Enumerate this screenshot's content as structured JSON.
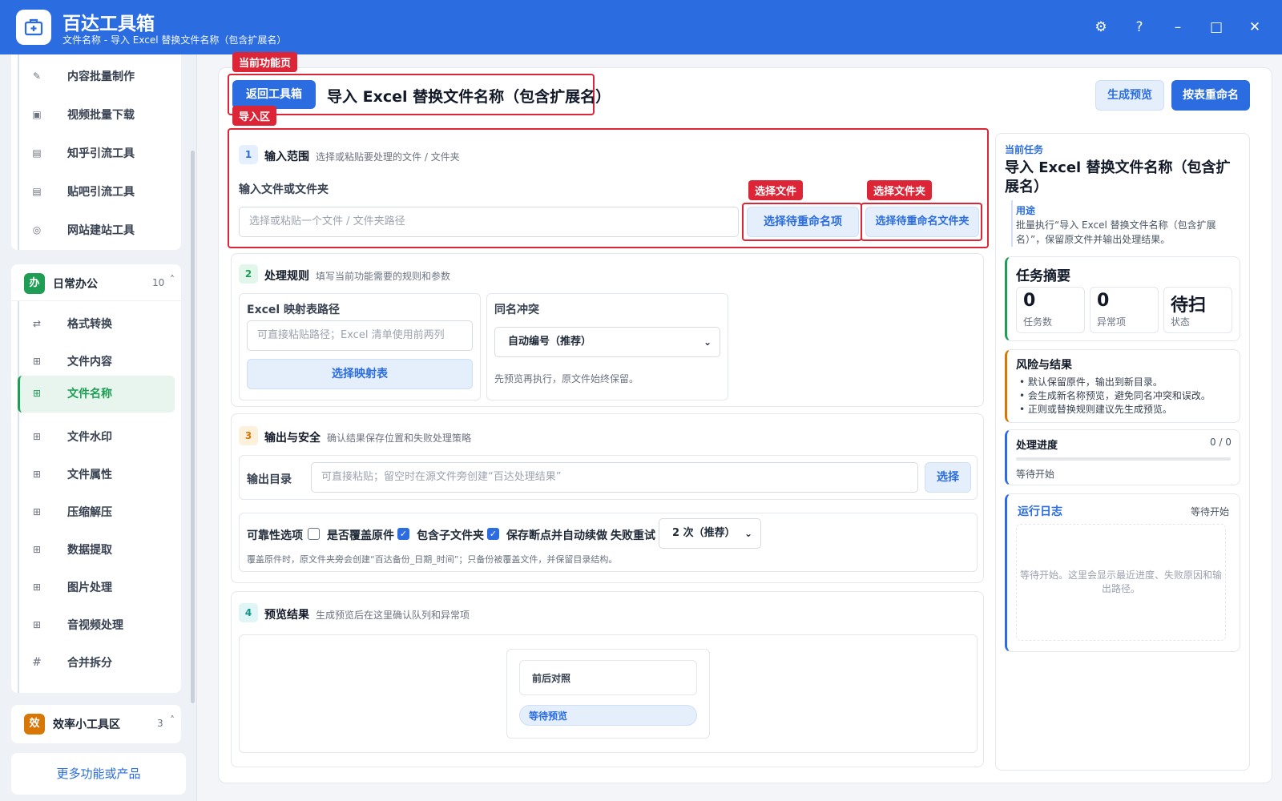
{
  "app": {
    "title": "百达工具箱",
    "subtitle": "文件名称 - 导入 Excel 替换文件名称（包含扩展名）"
  },
  "window_controls": {
    "settings": "⚙",
    "help": "?",
    "minimize": "–",
    "maximize": "□",
    "close": "✕"
  },
  "sidebar": {
    "top_items": [
      {
        "label": "内容批量制作",
        "icon": "pencil-icon"
      },
      {
        "label": "视频批量下载",
        "icon": "video-icon"
      },
      {
        "label": "知乎引流工具",
        "icon": "zhihu-icon"
      },
      {
        "label": "贴吧引流工具",
        "icon": "tieba-icon"
      },
      {
        "label": "网站建站工具",
        "icon": "globe-icon"
      }
    ],
    "group_office": {
      "badge": "办",
      "label": "日常办公",
      "count": "10",
      "chevron": "˄",
      "items": [
        {
          "label": "格式转换",
          "icon": "swap-icon"
        },
        {
          "label": "文件内容",
          "icon": "grid-icon"
        },
        {
          "label": "文件名称",
          "icon": "grid-icon",
          "active": true
        },
        {
          "label": "文件水印",
          "icon": "grid-icon"
        },
        {
          "label": "文件属性",
          "icon": "grid-icon"
        },
        {
          "label": "压缩解压",
          "icon": "grid-icon"
        },
        {
          "label": "数据提取",
          "icon": "grid-icon"
        },
        {
          "label": "图片处理",
          "icon": "grid-icon"
        },
        {
          "label": "音视频处理",
          "icon": "grid-icon"
        },
        {
          "label": "合并拆分",
          "icon": "hash-icon"
        }
      ]
    },
    "group_tools": {
      "badge": "效",
      "label": "效率小工具区",
      "count": "3",
      "chevron": "˄"
    },
    "more_link": "更多功能或产品"
  },
  "annotations": {
    "current_page": "当前功能页",
    "import_area": "导入区",
    "select_file": "选择文件",
    "select_folder": "选择文件夹"
  },
  "header": {
    "back_button": "返回工具箱",
    "page_title": "导入 Excel 替换文件名称（包含扩展名）",
    "preview_button": "生成预览",
    "rename_button": "按表重命名"
  },
  "section1": {
    "step": "1",
    "title": "输入范围",
    "desc": "选择或粘贴要处理的文件 / 文件夹",
    "field_label": "输入文件或文件夹",
    "input_placeholder": "选择或粘贴一个文件 / 文件夹路径",
    "select_items_button": "选择待重命名项",
    "select_folder_button": "选择待重命名文件夹"
  },
  "section2": {
    "step": "2",
    "title": "处理规则",
    "desc": "填写当前功能需要的规则和参数",
    "excel_label": "Excel 映射表路径",
    "excel_placeholder": "可直接粘贴路径；Excel 清单使用前两列",
    "excel_button": "选择映射表",
    "conflict_label": "同名冲突",
    "conflict_value": "自动编号（推荐）",
    "conflict_hint": "先预览再执行，原文件始终保留。"
  },
  "section3": {
    "step": "3",
    "title": "输出与安全",
    "desc": "确认结果保存位置和失败处理策略",
    "output_label": "输出目录",
    "output_placeholder": "可直接粘贴；留空时在源文件旁创建“百达处理结果”",
    "output_button": "选择",
    "reliability_label": "可靠性选项",
    "overwrite_label": "是否覆盖原件",
    "overwrite_checked": false,
    "subfolder_label": "包含子文件夹",
    "subfolder_checked": true,
    "resume_label": "保存断点并自动续做",
    "resume_checked": true,
    "retry_label": "失败重试",
    "retry_value": "2 次（推荐）",
    "note": "覆盖原件时，原文件夹旁会创建“百达备份_日期_时间”；只备份被覆盖文件，并保留目录结构。"
  },
  "section4": {
    "step": "4",
    "title": "预览结果",
    "desc": "生成预览后在这里确认队列和异常项",
    "compare_label": "前后对照",
    "status_pill": "等待预览"
  },
  "right_panel": {
    "task_eyebrow": "当前任务",
    "task_title": "导入 Excel 替换文件名称（包含扩展名）",
    "usage_label": "用途",
    "usage_text": "批量执行“导入 Excel 替换文件名称（包含扩展名）”，保留原文件并输出处理结果。",
    "summary_title": "任务摘要",
    "stats": [
      {
        "value": "0",
        "key": "任务数"
      },
      {
        "value": "0",
        "key": "异常项"
      },
      {
        "value": "待扫",
        "key": "状态"
      }
    ],
    "risk_title": "风险与结果",
    "risk_items": [
      "默认保留原件，输出到新目录。",
      "会生成新名称预览，避免同名冲突和误改。",
      "正则或替换规则建议先生成预览。"
    ],
    "progress_title": "处理进度",
    "progress_count": "0 / 0",
    "progress_value": 0,
    "progress_status": "等待开始",
    "log_title": "运行日志",
    "log_status": "等待开始",
    "log_placeholder": "等待开始。这里会显示最近进度、失败原因和输出路径。"
  },
  "colors": {
    "brand": "#2b6de0",
    "annotation_red": "#dc2638",
    "active_green": "#1f9d55",
    "office_badge": "#1f9d55",
    "tools_badge": "#d97706"
  }
}
